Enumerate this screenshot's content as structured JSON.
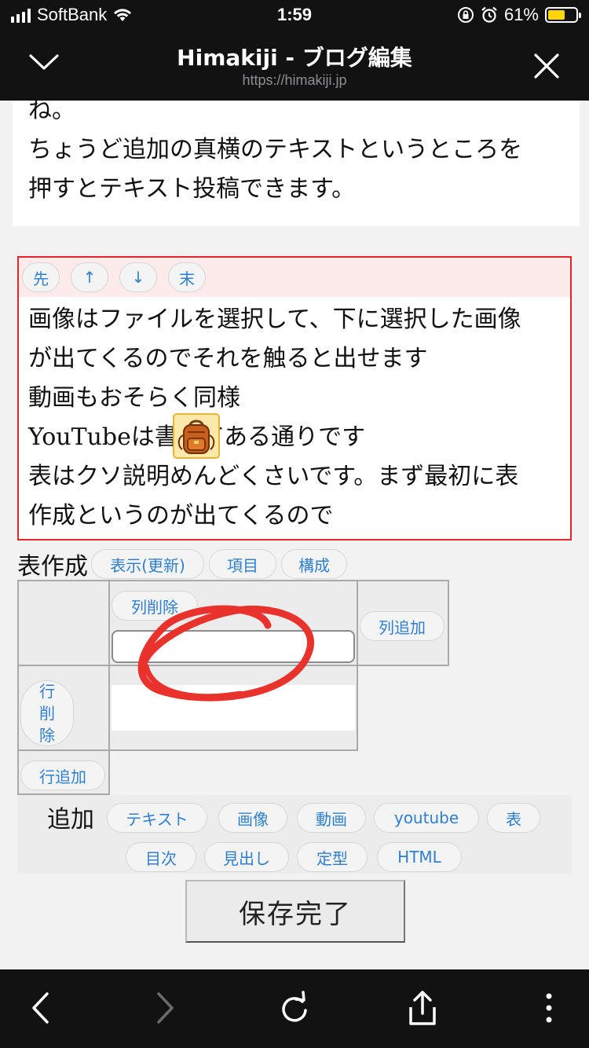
{
  "status_bar": {
    "carrier": "SoftBank",
    "time": "1:59",
    "battery": "61%",
    "battery_level": 0.61
  },
  "nav": {
    "title": "Himakiji - ブログ編集",
    "url": "https://himakiji.jp"
  },
  "editor": {
    "text_block_1": [
      "ね。",
      "ちょうど追加の真横のテキストというところを",
      "押すとテキスト投稿できます。"
    ],
    "selected_block": {
      "controls": [
        "先",
        "↑",
        "↓",
        "末"
      ],
      "lines": [
        "画像はファイルを選択して、下に選択した画像",
        "が出てくるのでそれを触ると出せます",
        "動画もおそらく同様",
        "YouTubeは書いてある通りです",
        "表はクソ説明めんどくさいです。まず最初に表",
        "作成というのが出てくるので"
      ]
    },
    "table_builder": {
      "label": "表作成",
      "buttons": [
        "表示(更新)",
        "項目",
        "構成"
      ],
      "delete_column": "列削除",
      "add_column": "列追加",
      "delete_row": "行\n削\n除",
      "add_row": "行追加",
      "cell_input_value": ""
    },
    "add_panel": {
      "label": "追加",
      "buttons_row1": [
        "テキスト",
        "画像",
        "動画",
        "youtube",
        "表"
      ],
      "buttons_row2": [
        "目次",
        "見出し",
        "定型",
        "HTML"
      ]
    },
    "save_button": "保存完了"
  },
  "colors": {
    "accent_link": "#2f7fd1",
    "selection_border": "#e5252a",
    "bar_background": "#121212",
    "battery_fill": "#ffd60a"
  },
  "icons": [
    "chevron-down-icon",
    "close-icon",
    "back-arrow-icon",
    "forward-arrow-icon",
    "reload-icon",
    "share-icon",
    "more-vertical-icon",
    "backpack-sticker-icon"
  ]
}
